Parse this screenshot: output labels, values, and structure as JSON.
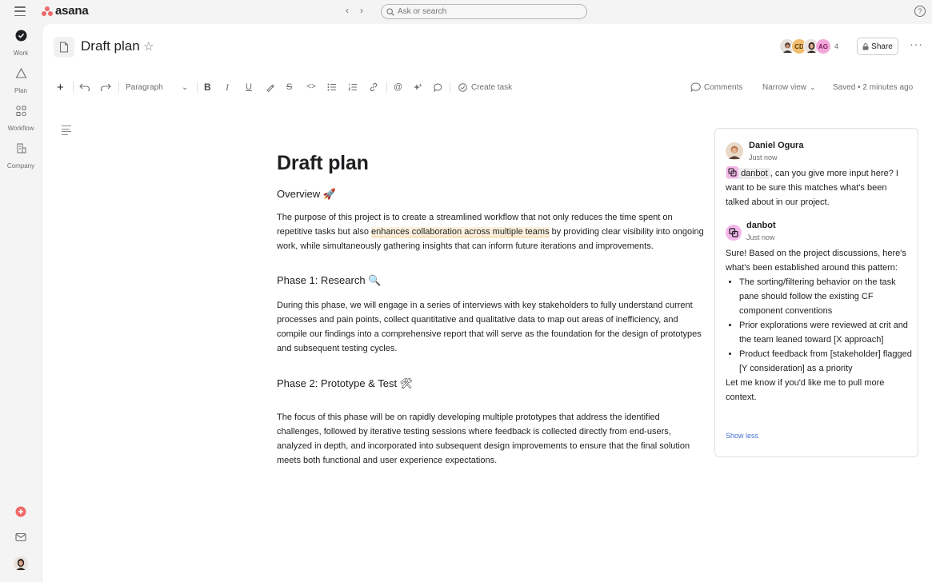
{
  "topbar": {
    "logo_text": "asana",
    "search_placeholder": "Ask or search",
    "help_label": "?"
  },
  "sidebar": {
    "items": [
      {
        "label": "Work",
        "icon": "check-circle-icon"
      },
      {
        "label": "Plan",
        "icon": "triangle-icon"
      },
      {
        "label": "Workflow",
        "icon": "workflow-icon"
      },
      {
        "label": "Company",
        "icon": "building-icon"
      }
    ],
    "bottom": [
      "create-plus-icon",
      "inbox-icon",
      "user-avatar"
    ]
  },
  "header": {
    "title": "Draft plan",
    "avatar_initials": [
      "CD",
      "AG"
    ],
    "member_count": "4",
    "share_label": "Share",
    "more_label": "···"
  },
  "toolbar": {
    "paragraph_label": "Paragraph",
    "create_task_label": "Create task",
    "comments_label": "Comments",
    "view_label": "Narrow view",
    "saved_status": "Saved • 2 minutes ago"
  },
  "doc": {
    "title": "Draft plan",
    "overview_heading": "Overview 🚀",
    "overview_text_before": "The purpose of this project is to create a streamlined workflow that not only reduces the time spent on repetitive tasks but also ",
    "overview_highlight": "enhances collaboration across multiple teams",
    "overview_text_after": " by providing clear visibility into ongoing work, while simultaneously gathering insights that can inform future iterations and improvements.",
    "phase1_heading": "Phase 1: Research 🔍",
    "phase1_text": "During this phase, we will engage in a series of interviews with key stakeholders to fully understand current processes and pain points, collect quantitative and qualitative data to map out areas of inefficiency, and compile our findings into a comprehensive report that will serve as the foundation for the design of prototypes and subsequent testing cycles.",
    "phase2_heading": "Phase 2: Prototype & Test 🛠",
    "phase2_text": "The focus of this phase will be on rapidly developing multiple prototypes that address the identified challenges, followed by iterative testing sessions where feedback is collected directly from end-users, analyzed in depth, and incorporated into subsequent design improvements to ensure that the final solution meets both functional and user experience expectations."
  },
  "comments": {
    "first": {
      "author": "Daniel Ogura",
      "time": "Just now",
      "mention": "danbot",
      "text": ", can you give more input here? I want to be sure this matches what's been talked about in our project."
    },
    "second": {
      "author": "danbot",
      "time": "Just now",
      "intro": "Sure! Based on the project discussions, here's what's been established around this pattern:",
      "bullets": [
        "The sorting/filtering behavior on the task pane should follow the existing CF component conventions",
        "Prior explorations were reviewed at crit and the team leaned toward [X approach]",
        "Product feedback from [stakeholder] flagged [Y consideration] as a priority"
      ],
      "outro": "Let me know if you'd like me to pull more context."
    },
    "show_less": "Show less"
  },
  "colors": {
    "brand": "#f06a6a",
    "highlight": "#fdf0dd",
    "link": "#4573d2",
    "danbot": "#e362e3"
  }
}
